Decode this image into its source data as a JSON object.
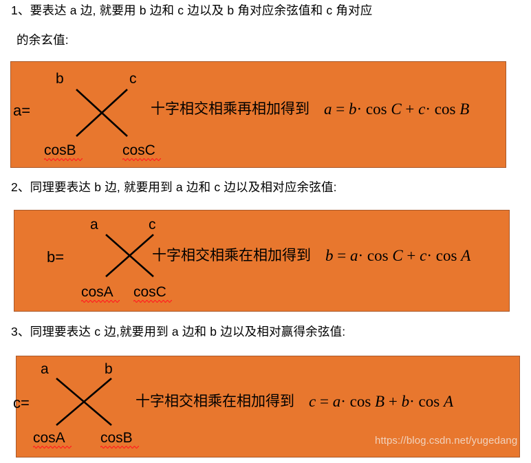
{
  "document": {
    "watermark": "https://blog.csdn.net/yugedang",
    "panel_color": "#E8772E",
    "panel_border_color": "#A8582A",
    "spellcheck_underline_color": "#ff2020"
  },
  "sections": [
    {
      "heading_line_1": "1、要表达 a 边, 就要用 b 边和 c 边以及 b 角对应余弦值和 c 角对应",
      "heading_line_2": "的余玄值:",
      "panel": {
        "lhs": "a=",
        "top_labels": [
          "b",
          "c"
        ],
        "bottom_labels": [
          "cosB",
          "cosC"
        ],
        "rule_text": "十字相交相乘再相加得到",
        "formula_plain": "a = b · cos C + c · cos B",
        "formula_parts": {
          "lhs_var": "a",
          "eq": "=",
          "t1_var": "b",
          "t1_dot": "·",
          "t1_fn": "cos",
          "t1_angle": "C",
          "plus": "+",
          "t2_var": "c",
          "t2_dot": "·",
          "t2_fn": "cos",
          "t2_angle": "B"
        }
      }
    },
    {
      "heading_line_1": "2、同理要表达 b 边, 就要用到 a 边和 c 边以及相对应余弦值:",
      "heading_line_2": "",
      "panel": {
        "lhs": "b=",
        "top_labels": [
          "a",
          "c"
        ],
        "bottom_labels": [
          "cosA",
          "cosC"
        ],
        "rule_text": "十字相交相乘在相加得到",
        "formula_plain": "b = a · cos C + c · cos A",
        "formula_parts": {
          "lhs_var": "b",
          "eq": "=",
          "t1_var": "a",
          "t1_dot": "·",
          "t1_fn": "cos",
          "t1_angle": "C",
          "plus": "+",
          "t2_var": "c",
          "t2_dot": "·",
          "t2_fn": "cos",
          "t2_angle": "A"
        }
      }
    },
    {
      "heading_line_1": "3、同理要表达 c 边,就要用到 a 边和 b 边以及相对赢得余弦值:",
      "heading_line_2": "",
      "panel": {
        "lhs": "c=",
        "top_labels": [
          "a",
          "b"
        ],
        "bottom_labels": [
          "cosA",
          "cosB"
        ],
        "rule_text": "十字相交相乘在相加得到",
        "formula_plain": "c = a · cos B + b · cos A",
        "formula_parts": {
          "lhs_var": "c",
          "eq": "=",
          "t1_var": "a",
          "t1_dot": "·",
          "t1_fn": "cos",
          "t1_angle": "B",
          "plus": "+",
          "t2_var": "b",
          "t2_dot": "·",
          "t2_fn": "cos",
          "t2_angle": "A"
        }
      }
    }
  ]
}
